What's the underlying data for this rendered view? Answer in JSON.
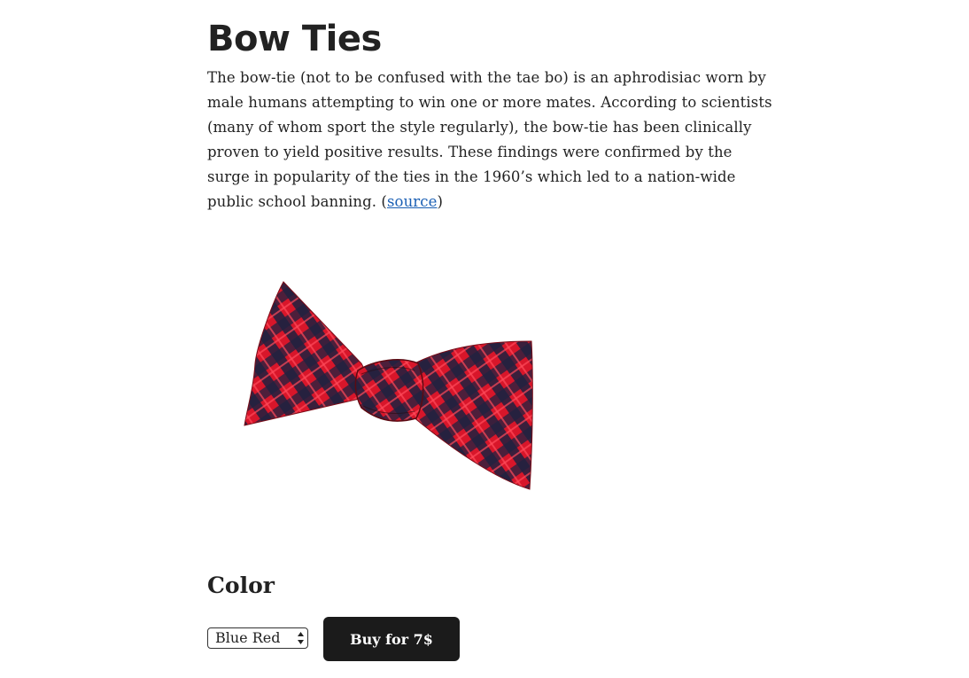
{
  "heading": "Bow Ties",
  "description": {
    "text": "The bow-tie (not to be confused with the tae bo) is an aphrodisiac worn by male humans attempting to win one or more mates. According to scientists (many of whom sport the style regularly), the bow-tie has been clinically proven to yield positive results. These findings were confirmed by the surge in popularity of the ties in the 1960’s which led to a nation-wide public school banning. (",
    "link_label": "source",
    "after_link": ")"
  },
  "product_image": {
    "icon": "bow-tie-image",
    "colors": [
      "#e8192c",
      "#1c1f3a"
    ]
  },
  "color_section": {
    "title": "Color",
    "selected_option": "Blue Red"
  },
  "buy_button": {
    "label": "Buy for 7$",
    "background": "#1b1b1b"
  }
}
